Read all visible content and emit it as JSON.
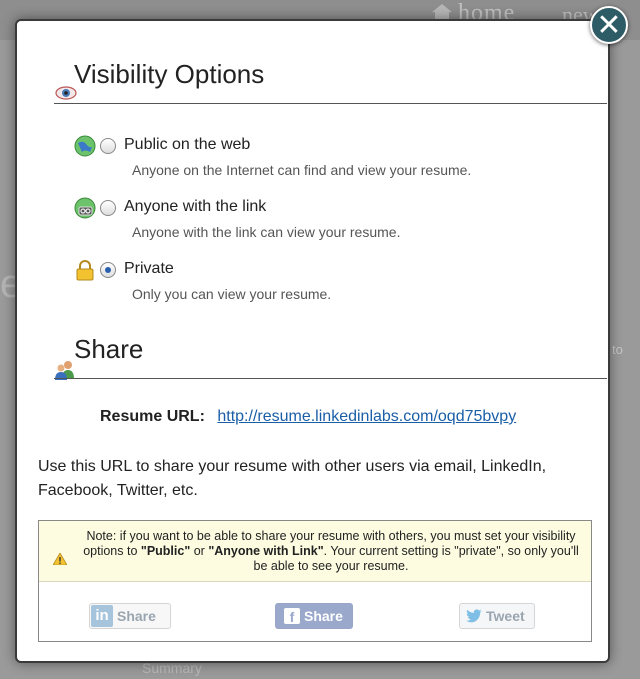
{
  "background": {
    "nav_home": "home",
    "nav_new": "new",
    "side_text": "to",
    "heading_fragment": "e mo",
    "summary": "Summary"
  },
  "modal": {
    "close_label": "✕",
    "visibility": {
      "title": "Visibility Options",
      "options": [
        {
          "label": "Public on the web",
          "description": "Anyone on the Internet can find and view your resume.",
          "icon": "globe-icon",
          "selected": false
        },
        {
          "label": "Anyone with the link",
          "description": "Anyone with the link can view your resume.",
          "icon": "globe-link-icon",
          "selected": false
        },
        {
          "label": "Private",
          "description": "Only you can view your resume.",
          "icon": "lock-icon",
          "selected": true
        }
      ]
    },
    "share": {
      "title": "Share",
      "url_label": "Resume URL:",
      "url": "http://resume.linkedinlabs.com/oqd75bvpy",
      "description": "Use this URL to share your resume with other users via email, LinkedIn, Facebook, Twitter, etc.",
      "note_part1": "Note: if you want to be able to share your resume with others, you must set your visibility options to ",
      "note_public": "\"Public\"",
      "note_or": " or ",
      "note_anyone": "\"Anyone with Link\"",
      "note_part2": ". Your current setting is \"private\", so only you'll be able to see your resume.",
      "buttons": {
        "linkedin_logo": "in",
        "linkedin": "Share",
        "facebook_logo": "f",
        "facebook": "Share",
        "twitter": "Tweet"
      }
    }
  },
  "colors": {
    "close_button": "#2e5c66",
    "link": "#1a5ea8",
    "note_background": "#fdfce1",
    "facebook_button": "#9aa8cc"
  }
}
